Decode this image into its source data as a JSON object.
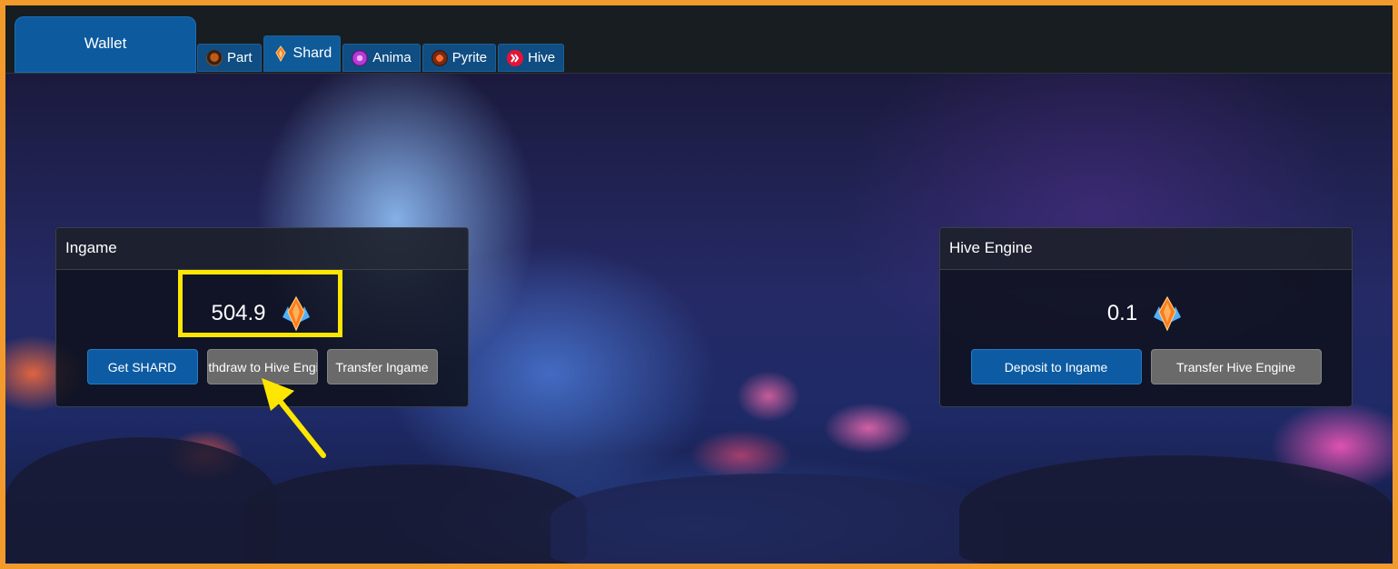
{
  "window": {
    "title": "Wallet"
  },
  "tabs": [
    {
      "label": "Part",
      "icon": "part-icon"
    },
    {
      "label": "Shard",
      "icon": "shard-icon",
      "active": true
    },
    {
      "label": "Anima",
      "icon": "anima-icon"
    },
    {
      "label": "Pyrite",
      "icon": "pyrite-icon"
    },
    {
      "label": "Hive",
      "icon": "hive-icon"
    }
  ],
  "ingame": {
    "title": "Ingame",
    "amount": "504.9",
    "buttons": {
      "get": "Get SHARD",
      "withdraw": "ithdraw to Hive Engi",
      "transfer": "Transfer Ingame"
    }
  },
  "hive_engine": {
    "title": "Hive Engine",
    "amount": "0.1",
    "buttons": {
      "deposit": "Deposit to Ingame",
      "transfer": "Transfer Hive Engine"
    }
  },
  "colors": {
    "accent": "#0d5ba3",
    "highlight": "#ffe600",
    "frame": "#f39a2c"
  }
}
